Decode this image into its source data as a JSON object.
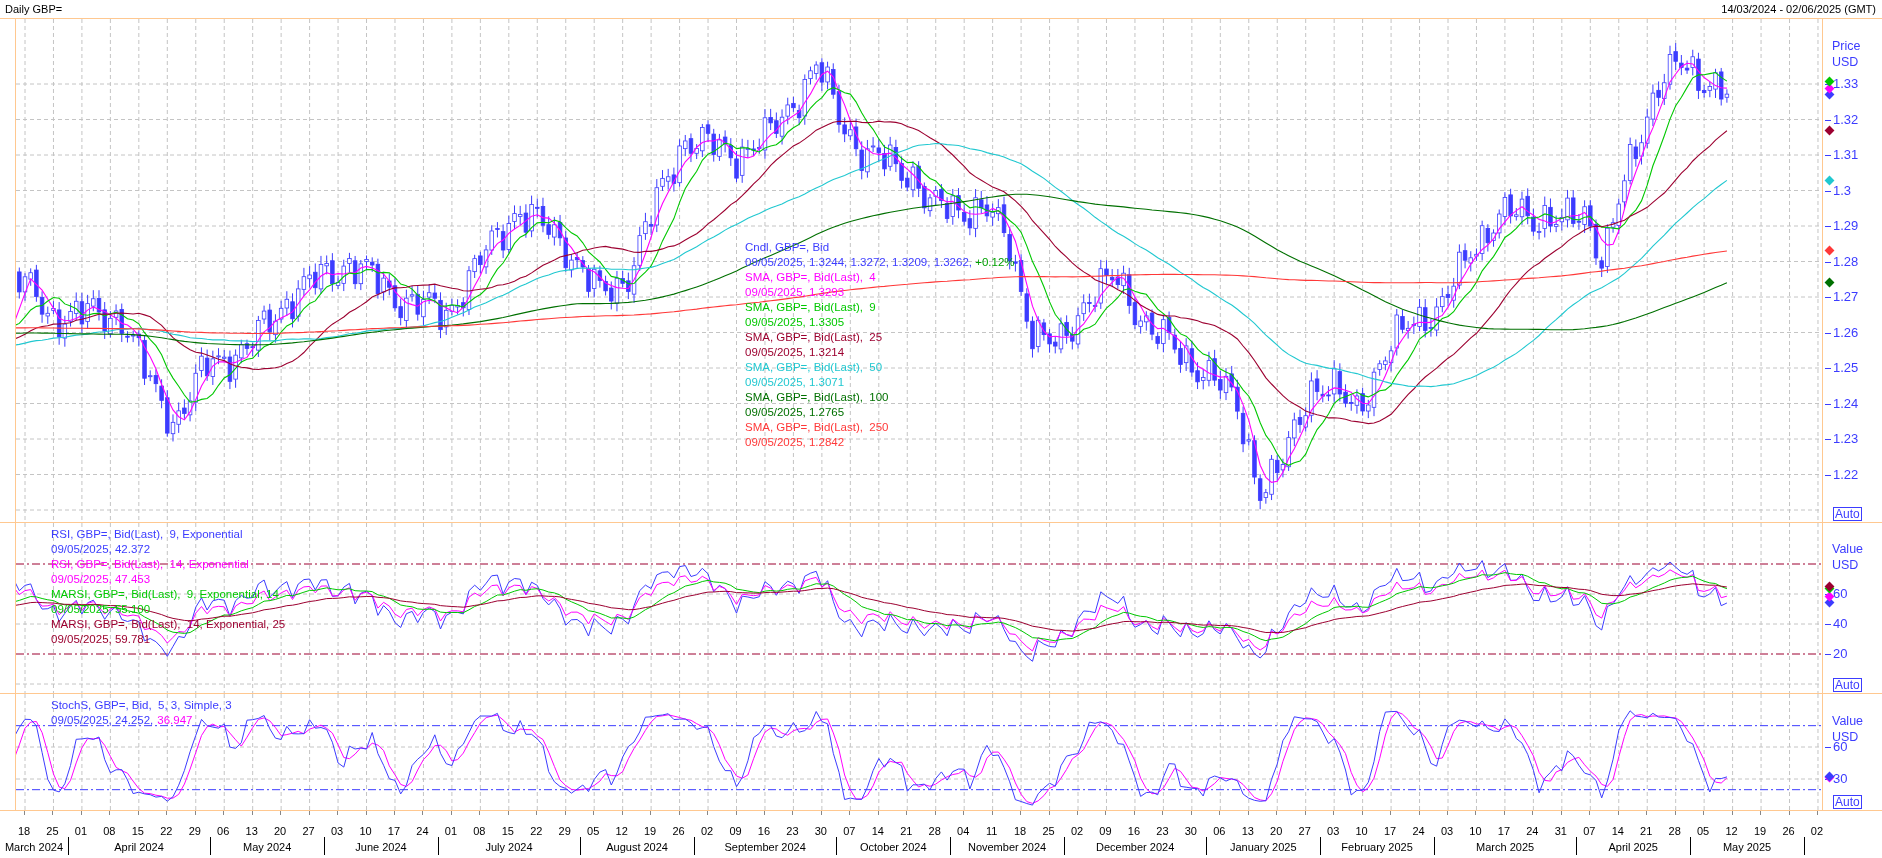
{
  "header": {
    "title": "Daily GBP=",
    "date_range": "14/03/2024 - 02/06/2025 (GMT)"
  },
  "price_panel": {
    "legend": [
      {
        "kind": "candles",
        "title": "Cndl, GBP=, Bid",
        "value": "09/05/2025, 1.3244, 1.3272, 1.3209, 1.3262,",
        "change": "+0.12%",
        "color": "#3c3cff"
      },
      {
        "kind": "sma",
        "title": "SMA, GBP=, Bid(Last),  4",
        "value": "09/05/2025, 1.3293",
        "color": "#ff00ff"
      },
      {
        "kind": "sma",
        "title": "SMA, GBP=, Bid(Last),  9",
        "value": "09/05/2025, 1.3305",
        "color": "#00c800"
      },
      {
        "kind": "sma",
        "title": "SMA, GBP=, Bid(Last),  25",
        "value": "09/05/2025, 1.3214",
        "color": "#9c0030"
      },
      {
        "kind": "sma",
        "title": "SMA, GBP=, Bid(Last),  50",
        "value": "09/05/2025, 1.3071",
        "color": "#20c8d0"
      },
      {
        "kind": "sma",
        "title": "SMA, GBP=, Bid(Last),  100",
        "value": "09/05/2025, 1.2765",
        "color": "#007000"
      },
      {
        "kind": "sma",
        "title": "SMA, GBP=, Bid(Last),  250",
        "value": "09/05/2025, 1.2842",
        "color": "#ff3838"
      }
    ],
    "axis": {
      "unit": [
        "Price",
        "USD"
      ],
      "ticks": [
        "1.33",
        "1.32",
        "1.31",
        "1.3",
        "1.29",
        "1.28",
        "1.27",
        "1.26",
        "1.25",
        "1.24",
        "1.23",
        "1.22"
      ],
      "auto": "Auto"
    }
  },
  "rsi_panel": {
    "legend": [
      {
        "kind": "rsi",
        "title": "RSI, GBP=, Bid(Last),  9, Exponential",
        "value": "09/05/2025, 42.372",
        "color": "#3c3cff"
      },
      {
        "kind": "rsi",
        "title": "RSI, GBP=, Bid(Last),  14, Exponential",
        "value": "09/05/2025, 47.453",
        "color": "#ff00ff"
      },
      {
        "kind": "marsi",
        "title": "MARSI, GBP=, Bid(Last),  9, Exponential, 14",
        "value": "09/05/2025, 55.100",
        "color": "#00c800"
      },
      {
        "kind": "marsi",
        "title": "MARSI, GBP=, Bid(Last),  14, Exponential, 25",
        "value": "09/05/2025, 59.781",
        "color": "#9c0030"
      }
    ],
    "axis": {
      "unit": [
        "Value",
        "USD"
      ],
      "ticks": [
        "60",
        "40",
        "20"
      ],
      "auto": "Auto"
    }
  },
  "stoch_panel": {
    "legend": [
      {
        "kind": "stoch",
        "title": "StochS, GBP=, Bid,  5, 3, Simple, 3",
        "color": "#3c3cff",
        "values": [
          {
            "text": "09/05/2025, 24.252,",
            "color": "#3c3cff"
          },
          {
            "text": "36.947",
            "color": "#ff00ff"
          }
        ]
      }
    ],
    "axis": {
      "unit": [
        "Value",
        "USD"
      ],
      "ticks": [
        "60",
        "30"
      ],
      "auto": "Auto"
    }
  },
  "date_axis": {
    "months": [
      {
        "label": "March 2024",
        "days": [
          "18",
          "25"
        ]
      },
      {
        "label": "April 2024",
        "days": [
          "01",
          "08",
          "15",
          "22",
          "29"
        ]
      },
      {
        "label": "May 2024",
        "days": [
          "06",
          "13",
          "20",
          "27"
        ]
      },
      {
        "label": "June 2024",
        "days": [
          "03",
          "10",
          "17",
          "24"
        ]
      },
      {
        "label": "July 2024",
        "days": [
          "01",
          "08",
          "15",
          "22",
          "29"
        ]
      },
      {
        "label": "August 2024",
        "days": [
          "05",
          "12",
          "19",
          "26"
        ]
      },
      {
        "label": "September 2024",
        "days": [
          "02",
          "09",
          "16",
          "23",
          "30"
        ]
      },
      {
        "label": "October 2024",
        "days": [
          "07",
          "14",
          "21",
          "28"
        ]
      },
      {
        "label": "November 2024",
        "days": [
          "04",
          "11",
          "18",
          "25"
        ]
      },
      {
        "label": "December 2024",
        "days": [
          "02",
          "09",
          "16",
          "23",
          "30"
        ]
      },
      {
        "label": "January 2025",
        "days": [
          "06",
          "13",
          "20",
          "27"
        ]
      },
      {
        "label": "February 2025",
        "days": [
          "03",
          "10",
          "17",
          "24"
        ]
      },
      {
        "label": "March 2025",
        "days": [
          "03",
          "10",
          "17",
          "24",
          "31"
        ]
      },
      {
        "label": "April 2025",
        "days": [
          "07",
          "14",
          "21",
          "28"
        ]
      },
      {
        "label": "May 2025",
        "days": [
          "05",
          "12",
          "19",
          "26"
        ]
      },
      {
        "days": [
          "02"
        ]
      }
    ]
  }
}
